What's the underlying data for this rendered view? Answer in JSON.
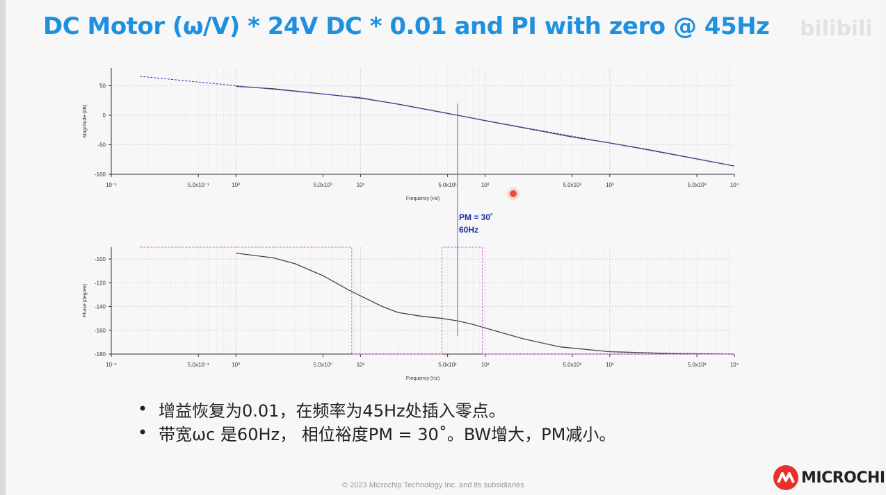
{
  "title": "DC Motor (ω/V) * 24V DC * 0.01 and PI with zero @ 45Hz",
  "watermark": "bilibili",
  "annotation": {
    "pm": "PM = 30˚",
    "freq": "60Hz"
  },
  "bullets": [
    "增益恢复为0.01，在频率为45Hz处插入零点。",
    "带宽ωc 是60Hz， 相位裕度PM = 30˚。BW增大，PM减小。"
  ],
  "footer": "© 2023 Microchip Technology Inc. and its subsidiaries",
  "logo": "MICROCHIP",
  "colors": {
    "title": "#1e90e0",
    "curve": "#444444",
    "asymptote": "#3a3ad0",
    "phase_box": "#e066e0",
    "marker": "#6a6ad8",
    "annotation": "#1c2ea8"
  },
  "chart_data": [
    {
      "type": "line",
      "xlabel": "Frequency (Hz)",
      "ylabel": "Magnitude (dB)",
      "xscale": "log",
      "xlim": [
        0.1,
        10000
      ],
      "ylim": [
        -100,
        80
      ],
      "yticks": [
        -100,
        -50,
        0,
        50
      ],
      "xtick_labels": [
        "10⁻¹",
        "5.0x10⁻¹",
        "10⁰",
        "5.0x10⁰",
        "10¹",
        "5.0x10¹",
        "10²",
        "5.0x10²",
        "10³",
        "5.0x10³",
        "10⁴"
      ],
      "grid": true,
      "series": [
        {
          "style": "solid",
          "x": [
            1,
            2,
            5,
            10,
            20,
            45,
            60,
            100,
            200,
            500,
            1000,
            2000,
            5000,
            10000
          ],
          "y": [
            49,
            45,
            36,
            29,
            19,
            5,
            0,
            -9,
            -21,
            -37,
            -47,
            -58,
            -74,
            -86
          ]
        },
        {
          "style": "dashed",
          "x": [
            0.17,
            1,
            10,
            45,
            100,
            1000,
            10000
          ],
          "y": [
            66,
            50,
            30,
            5,
            -9,
            -47,
            -86
          ]
        }
      ],
      "marker_x": 60
    },
    {
      "type": "line",
      "xlabel": "Frequency (Hz)",
      "ylabel": "Phase (degree)",
      "xscale": "log",
      "xlim": [
        0.1,
        10000
      ],
      "ylim": [
        -180,
        -90
      ],
      "yticks": [
        -180,
        -160,
        -140,
        -120,
        -100
      ],
      "xtick_labels": [
        "10⁻¹",
        "5.0x10⁻¹",
        "10⁰",
        "5.0x10⁰",
        "10¹",
        "5.0x10¹",
        "10²",
        "5.0x10²",
        "10³",
        "5.0x10³",
        "10⁴"
      ],
      "grid": true,
      "series": [
        {
          "style": "solid",
          "x": [
            1,
            2,
            3,
            5,
            8,
            10,
            15,
            20,
            30,
            45,
            60,
            80,
            100,
            200,
            400,
            1000,
            3000,
            10000
          ],
          "y": [
            -95,
            -99,
            -104,
            -114,
            -126,
            -131,
            -140,
            -145,
            -148,
            -150,
            -152,
            -155,
            -158,
            -167,
            -174,
            -178,
            -179.5,
            -180
          ]
        },
        {
          "style": "dashed-box",
          "x": [
            0.17,
            8.5,
            8.5,
            45,
            45,
            95,
            95,
            10000
          ],
          "y": [
            -90,
            -90,
            -180,
            -180,
            -90,
            -90,
            -180,
            -180
          ]
        }
      ],
      "marker_x": 60
    }
  ]
}
